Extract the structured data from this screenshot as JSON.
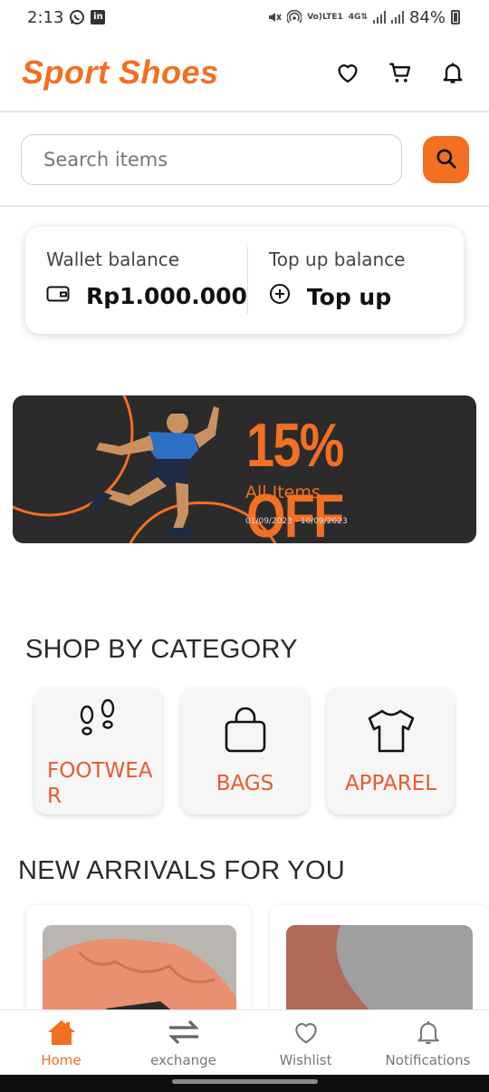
{
  "status_bar": {
    "time": "2:13",
    "left_icons": [
      "whatsapp-icon",
      "linkedin-icon"
    ],
    "network_top": "Vo)",
    "network_bottom": "LTE1",
    "network_type": "4G",
    "battery": "84%"
  },
  "header": {
    "brand": "Sport Shoes",
    "icons": [
      "heart-icon",
      "cart-icon",
      "bell-icon"
    ]
  },
  "search": {
    "placeholder": "Search items"
  },
  "wallet": {
    "balance_label": "Wallet balance",
    "balance_value": "Rp1.000.000",
    "topup_label": "Top up balance",
    "topup_action": "Top up"
  },
  "banner": {
    "headline": "15% OFF",
    "subtitle": "All Items",
    "dates": "01/09/2023 - 10/09/2023"
  },
  "categories": {
    "title": "SHOP BY CATEGORY",
    "items": [
      {
        "label": "FOOTWEAR",
        "icon": "footprints-icon"
      },
      {
        "label": "BAGS",
        "icon": "bag-icon"
      },
      {
        "label": "APPAREL",
        "icon": "tshirt-icon"
      }
    ]
  },
  "arrivals": {
    "title": "NEW ARRIVALS FOR YOU"
  },
  "bottom_nav": {
    "items": [
      {
        "label": "Home",
        "icon": "home-icon",
        "active": true
      },
      {
        "label": "exchange",
        "icon": "exchange-icon",
        "active": false
      },
      {
        "label": "Wishlist",
        "icon": "heart-icon",
        "active": false
      },
      {
        "label": "Notifications",
        "icon": "bell-icon",
        "active": false
      }
    ]
  },
  "colors": {
    "accent": "#f36f21",
    "banner_bg": "#2b2b2b"
  }
}
